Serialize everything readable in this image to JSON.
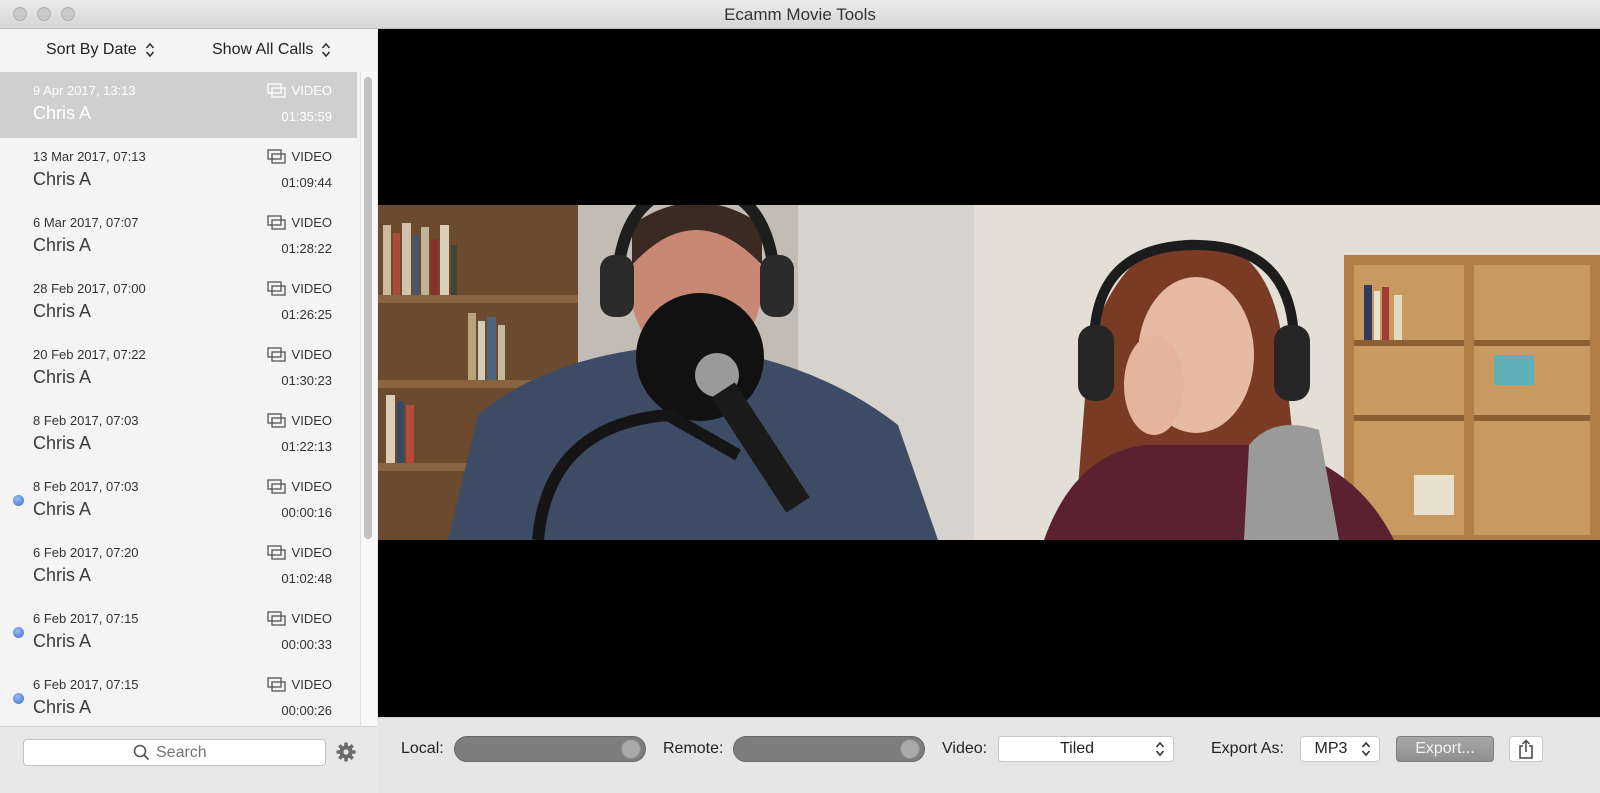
{
  "window": {
    "title": "Ecamm Movie Tools"
  },
  "sidebar": {
    "sort_label": "Sort By Date",
    "filter_label": "Show All Calls",
    "calls": [
      {
        "date": "9 Apr 2017, 13:13",
        "name": "Chris A",
        "type": "VIDEO",
        "duration": "01:35:59",
        "selected": true,
        "unread": false
      },
      {
        "date": "13 Mar 2017, 07:13",
        "name": "Chris A",
        "type": "VIDEO",
        "duration": "01:09:44",
        "selected": false,
        "unread": false
      },
      {
        "date": "6 Mar 2017, 07:07",
        "name": "Chris A",
        "type": "VIDEO",
        "duration": "01:28:22",
        "selected": false,
        "unread": false
      },
      {
        "date": "28 Feb 2017, 07:00",
        "name": "Chris A",
        "type": "VIDEO",
        "duration": "01:26:25",
        "selected": false,
        "unread": false
      },
      {
        "date": "20 Feb 2017, 07:22",
        "name": "Chris A",
        "type": "VIDEO",
        "duration": "01:30:23",
        "selected": false,
        "unread": false
      },
      {
        "date": "8 Feb 2017, 07:03",
        "name": "Chris A",
        "type": "VIDEO",
        "duration": "01:22:13",
        "selected": false,
        "unread": false
      },
      {
        "date": "8 Feb 2017, 07:03",
        "name": "Chris A",
        "type": "VIDEO",
        "duration": "00:00:16",
        "selected": false,
        "unread": true
      },
      {
        "date": "6 Feb 2017, 07:20",
        "name": "Chris A",
        "type": "VIDEO",
        "duration": "01:02:48",
        "selected": false,
        "unread": false
      },
      {
        "date": "6 Feb 2017, 07:15",
        "name": "Chris A",
        "type": "VIDEO",
        "duration": "00:00:33",
        "selected": false,
        "unread": true
      },
      {
        "date": "6 Feb 2017, 07:15",
        "name": "Chris A",
        "type": "VIDEO",
        "duration": "00:00:26",
        "selected": false,
        "unread": true
      }
    ],
    "search_placeholder": "Search"
  },
  "controls": {
    "local_label": "Local:",
    "local_level": 1.0,
    "remote_label": "Remote:",
    "remote_level": 1.0,
    "video_label": "Video:",
    "video_value": "Tiled",
    "export_as_label": "Export As:",
    "export_format": "MP3",
    "export_button": "Export..."
  },
  "colors": {
    "unread_dot": "#3c6fd6",
    "selected_row": "#cfcfcf",
    "video_bg": "#000000"
  },
  "icons": [
    "updown-icon",
    "video-call-icon",
    "search-icon",
    "gear-icon",
    "share-icon"
  ]
}
